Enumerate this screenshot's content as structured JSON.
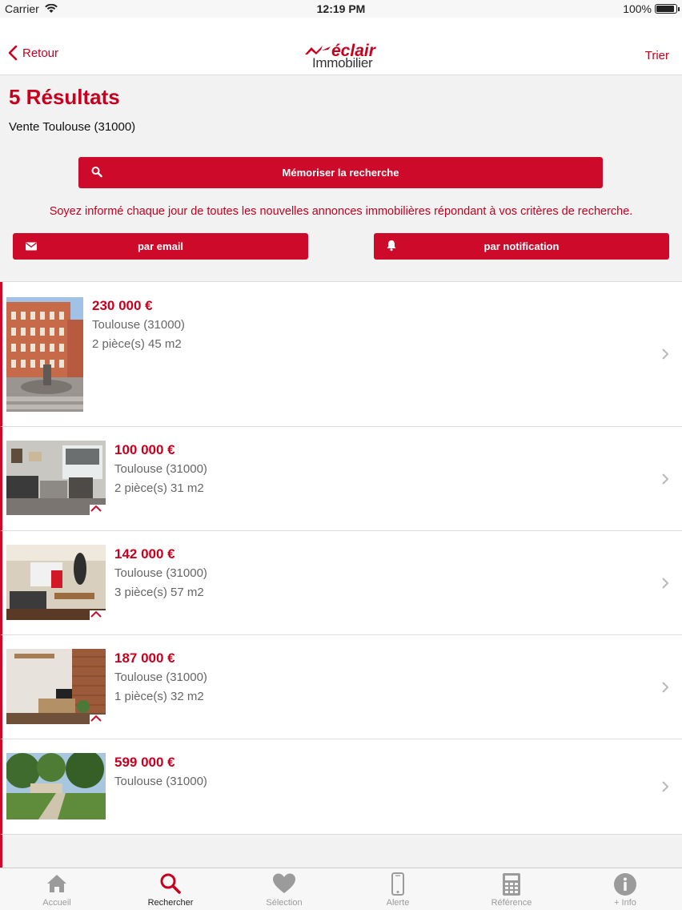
{
  "status": {
    "carrier": "Carrier",
    "time": "12:19 PM",
    "battery": "100%"
  },
  "nav": {
    "back_label": "Retour",
    "sort_label": "Trier",
    "logo_top": "éclair",
    "logo_bottom": "Immobilier"
  },
  "header": {
    "results_title": "5 Résultats",
    "search_subtitle": "Vente Toulouse (31000)",
    "save_search_label": "Mémoriser la recherche",
    "info_text": "Soyez informé chaque jour de toutes les nouvelles annonces immobilières répondant à vos critères de recherche.",
    "email_label": "par email",
    "notification_label": "par notification"
  },
  "listings": [
    {
      "price": "230 000  €",
      "city": "Toulouse (31000)",
      "details": "2 pièce(s) 45 m2"
    },
    {
      "price": "100 000  €",
      "city": "Toulouse (31000)",
      "details": "2 pièce(s) 31 m2"
    },
    {
      "price": "142 000  €",
      "city": "Toulouse (31000)",
      "details": "3 pièce(s) 57 m2"
    },
    {
      "price": "187 000  €",
      "city": "Toulouse (31000)",
      "details": "1 pièce(s) 32 m2"
    },
    {
      "price": "599 000  €",
      "city": "Toulouse (31000)",
      "details": ""
    }
  ],
  "tabs": [
    {
      "label": "Accueil",
      "icon": "home-icon"
    },
    {
      "label": "Rechercher",
      "icon": "search-icon"
    },
    {
      "label": "Sélection",
      "icon": "heart-icon"
    },
    {
      "label": "Alerte",
      "icon": "phone-icon"
    },
    {
      "label": "Référence",
      "icon": "calculator-icon"
    },
    {
      "label": "+ Info",
      "icon": "info-icon"
    }
  ],
  "active_tab": "Rechercher",
  "colors": {
    "accent": "#c8001e",
    "button": "#cd0a2a",
    "panel": "#f2f2f2"
  }
}
